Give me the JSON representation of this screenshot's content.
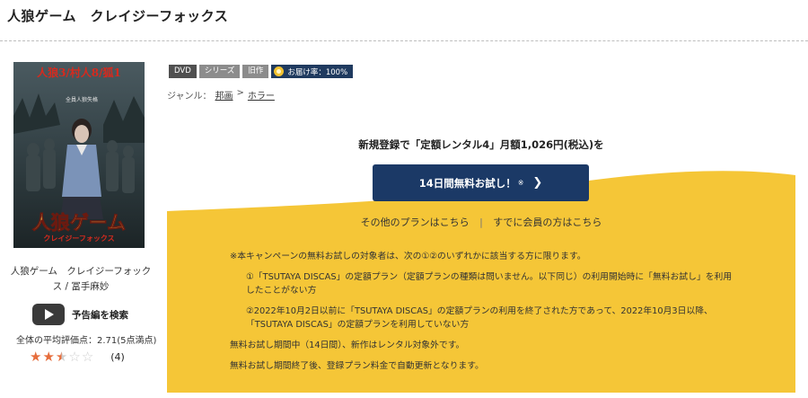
{
  "header": {
    "title": "人狼ゲーム　クレイジーフォックス"
  },
  "product": {
    "poster_title": "人狼ゲーム",
    "poster_subtitle": "クレイジーフォックス",
    "poster_tagline": "人狼3/村人8/狐1",
    "poster_caption": "全員人狼失格",
    "name": "人狼ゲーム　クレイジーフォックス / 冨手麻妙",
    "trailer_label": "予告編を検索",
    "rating_text": "全体の平均評価点：2.71(5点満点)",
    "rating": 2.71,
    "review_count": "(4)"
  },
  "badges": {
    "dvd": "DVD",
    "series": "シリーズ",
    "old": "旧作",
    "delivery": "お届け率：100%"
  },
  "genre": {
    "label": "ジャンル：",
    "item1": "邦画",
    "sep": ">",
    "item2": "ホラー"
  },
  "campaign": {
    "lead": "新規登録で「定額レンタル4」月額1,026円(税込)を",
    "trial_label": "14日間無料お試し！",
    "trial_mark": "※",
    "trial_chevron": "❯",
    "other_plans": "その他のプランはこちら",
    "link_sep": "|",
    "member_login": "すでに会員の方はこちら",
    "notes": {
      "n1": "※本キャンペーンの無料お試しの対象者は、次の①②のいずれかに該当する方に限ります。",
      "n2": "①「TSUTAYA DISCAS」の定額プラン（定額プランの種類は問いません。以下同じ）の利用開始時に「無料お試し」を利用したことがない方",
      "n3": "②2022年10月2日以前に「TSUTAYA DISCAS」の定額プランの利用を終了された方であって、2022年10月3日以降、「TSUTAYA DISCAS」の定額プランを利用していない方",
      "n4": "無料お試し期間中（14日間）、新作はレンタル対象外です。",
      "n5": "無料お試し期間終了後、登録プラン料金で自動更新となります。"
    }
  },
  "colors": {
    "accent_navy": "#1b3966",
    "campaign_yellow": "#f5c637",
    "star_orange": "#e66d3c"
  }
}
